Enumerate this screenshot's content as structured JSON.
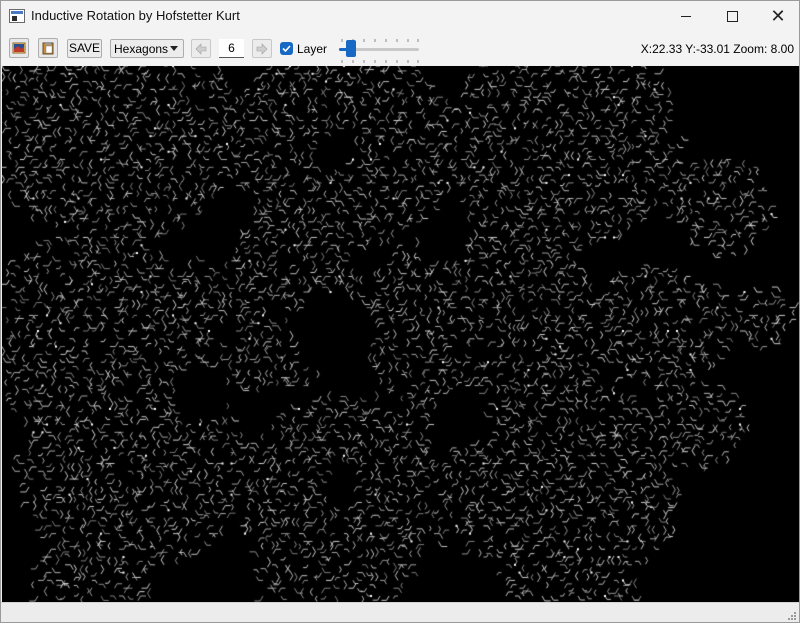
{
  "window": {
    "title": "Inductive Rotation by Hofstetter Kurt",
    "controls": {
      "minimize": "—",
      "maximize": "□",
      "close": "✕"
    }
  },
  "toolbar": {
    "open_icon": "image-open-icon",
    "paste_icon": "clipboard-icon",
    "save_label": "SAVE",
    "shape_select": {
      "value": "Hexagons"
    },
    "prev_icon": "arrow-left-icon",
    "iteration_value": "6",
    "next_icon": "arrow-right-icon",
    "layer_checkbox": {
      "label": "Layer",
      "checked": true
    },
    "layer_slider": {
      "value_fraction": 0.1
    },
    "status": "X:22.33 Y:-33.01 Zoom: 8.00"
  },
  "canvas": {
    "description_icon": "tiling-canvas",
    "background": "#000000",
    "pattern_color": "#d8d8d8"
  },
  "colors": {
    "accent": "#1769c4",
    "title_bg": "#f3f3f3"
  }
}
